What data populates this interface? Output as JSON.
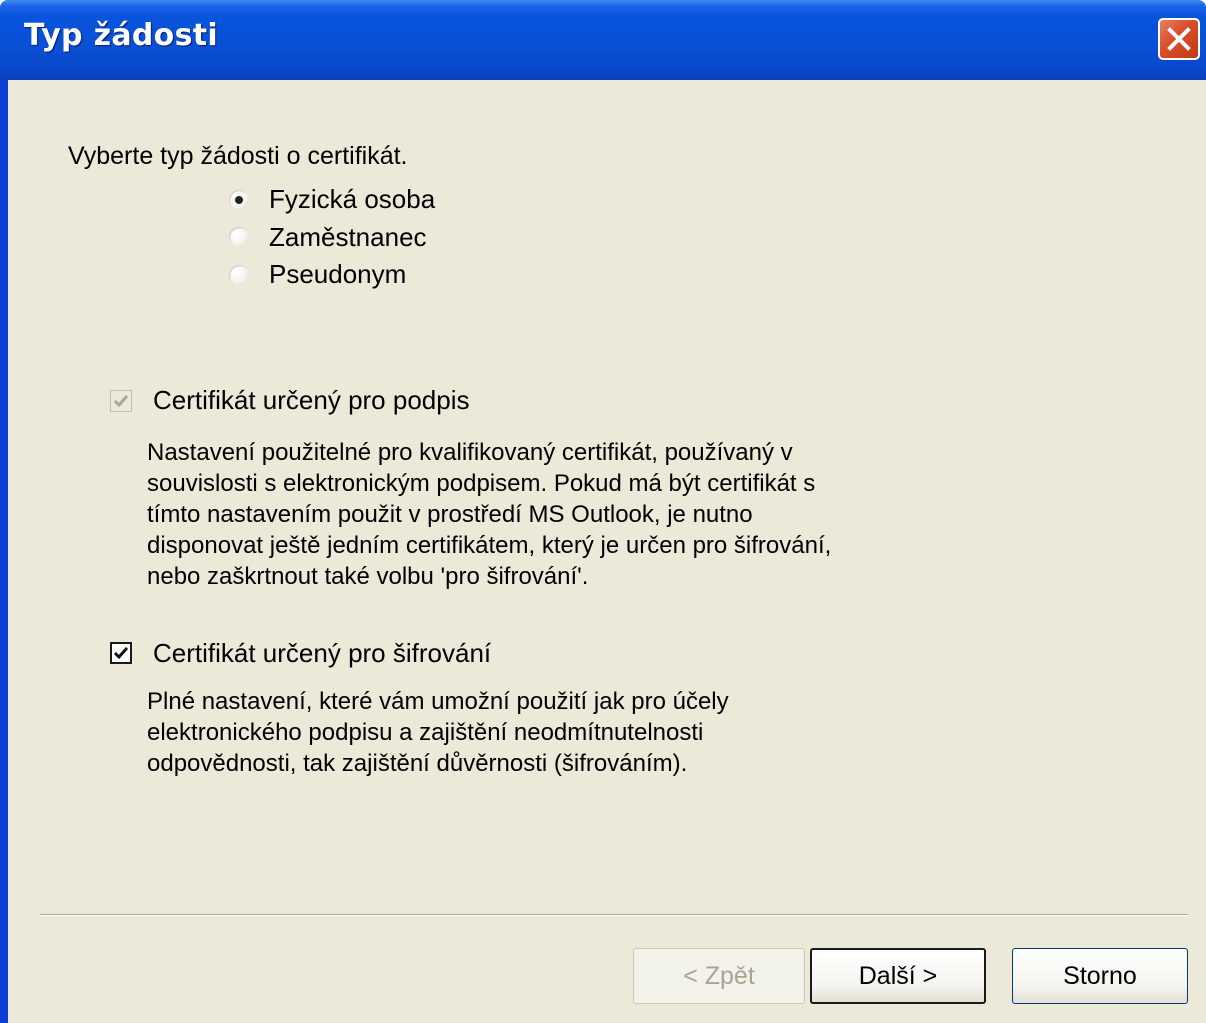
{
  "window": {
    "title": "Typ žádosti"
  },
  "request_type": {
    "prompt": "Vyberte typ žádosti o certifikát.",
    "options": [
      {
        "label": "Fyzická osoba",
        "selected": true
      },
      {
        "label": "Zaměstnanec",
        "selected": false
      },
      {
        "label": "Pseudonym",
        "selected": false
      }
    ]
  },
  "signing": {
    "label": "Certifikát určený pro podpis",
    "checked": true,
    "enabled": false,
    "description_lines": [
      "Nastavení použitelné pro kvalifikovaný certifikát, používaný v",
      "souvislosti s elektronickým podpisem. Pokud má být certifikát s",
      "tímto nastavením použit v prostředí MS Outlook, je nutno",
      "disponovat ještě jedním certifikátem, který je určen pro šifrování,",
      "nebo zaškrtnout také volbu 'pro šifrování'."
    ]
  },
  "encryption": {
    "label": "Certifikát určený pro šifrování",
    "checked": true,
    "enabled": true,
    "description_lines": [
      "Plné nastavení, které vám umožní použití jak pro účely",
      "elektronického podpisu a zajištění neodmítnutelnosti",
      "odpovědnosti, tak zajištění důvěrnosti (šifrováním)."
    ]
  },
  "buttons": {
    "back": "< Zpět",
    "next": "Další >",
    "cancel": "Storno"
  },
  "colors": {
    "titlebar": "#0a4fd4",
    "client": "#ece9d8",
    "close": "#d8502c"
  },
  "icons": {
    "close": "close-icon",
    "check": "checkmark-icon"
  }
}
